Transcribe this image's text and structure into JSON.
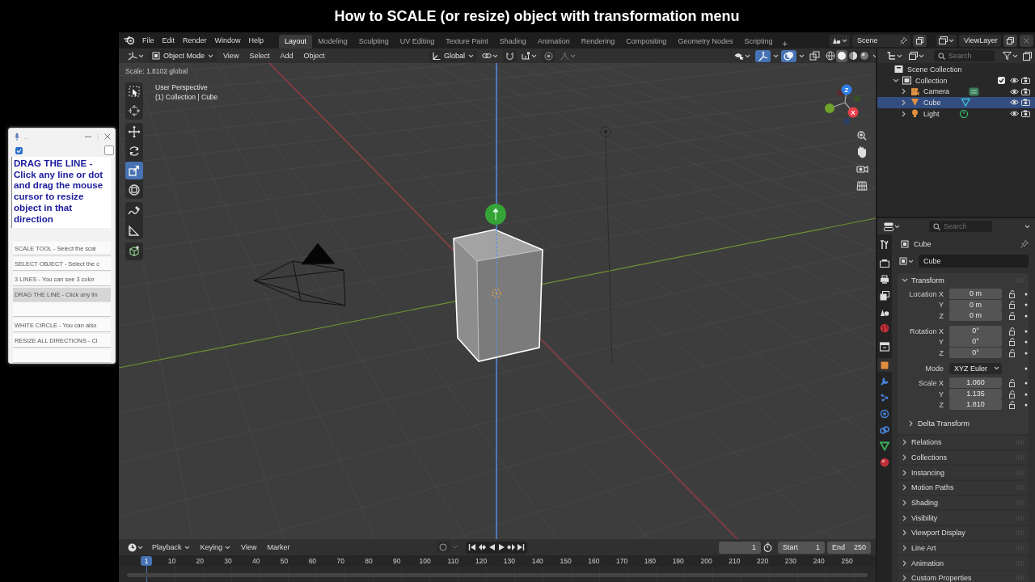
{
  "title": "How to SCALE (or resize) object with transformation menu",
  "helper": {
    "title": "..",
    "checkboxes": [
      {
        "checked": true
      },
      {
        "checked": false
      }
    ],
    "text": "DRAG THE LINE - Click any line or dot and drag the mouse cursor to resize object in that direction",
    "items": [
      {
        "kind": "entry",
        "label": "SCALE TOOL - Select the scal",
        "selected": false
      },
      {
        "kind": "entry",
        "label": "SELECT OBJECT - Select the c",
        "selected": false
      },
      {
        "kind": "entry",
        "label": "3 LINES - You can see 3 color",
        "selected": false
      },
      {
        "kind": "entry",
        "label": "DRAG THE LINE - Click any lin",
        "selected": true
      },
      {
        "kind": "blank",
        "selected": false
      },
      {
        "kind": "entry",
        "label": "WHITE CIRCLE - You can also",
        "selected": false
      },
      {
        "kind": "entry",
        "label": "RESIZE ALL DIRECTIONS - Cl",
        "selected": false
      },
      {
        "kind": "blank",
        "selected": false
      }
    ]
  },
  "topbar": {
    "menus": [
      "File",
      "Edit",
      "Render",
      "Window",
      "Help"
    ],
    "workspaces": [
      {
        "label": "Layout",
        "selected": true
      },
      {
        "label": "Modeling",
        "selected": false
      },
      {
        "label": "Sculpting",
        "selected": false
      },
      {
        "label": "UV Editing",
        "selected": false
      },
      {
        "label": "Texture Paint",
        "selected": false
      },
      {
        "label": "Shading",
        "selected": false
      },
      {
        "label": "Animation",
        "selected": false
      },
      {
        "label": "Rendering",
        "selected": false
      },
      {
        "label": "Compositing",
        "selected": false
      },
      {
        "label": "Geometry Nodes",
        "selected": false
      },
      {
        "label": "Scripting",
        "selected": false
      }
    ],
    "add": "+",
    "scene": "Scene",
    "view_layer": "ViewLayer"
  },
  "viewport": {
    "mode": "Object Mode",
    "menus": [
      "View",
      "Select",
      "Add",
      "Object"
    ],
    "orientation": "Global",
    "toggles": [
      {
        "kind": "gizmo",
        "on": true
      },
      {
        "kind": "overlay",
        "on": true
      },
      {
        "kind": "xray",
        "on": false
      }
    ],
    "shading": [
      {
        "kind": "wireframe",
        "selected": false
      },
      {
        "kind": "solid",
        "selected": true
      },
      {
        "kind": "material",
        "selected": false
      },
      {
        "kind": "rendered",
        "selected": false
      }
    ],
    "status": "Scale: 1.8102 global",
    "view_name": "User Perspective",
    "context": "(1) Collection | Cube",
    "tool_groups": [
      {
        "tools": [
          {
            "kind": "select_box",
            "selected": false
          },
          {
            "kind": "cursor",
            "selected": false
          }
        ]
      },
      {
        "tools": [
          {
            "kind": "move",
            "selected": false
          },
          {
            "kind": "rotate",
            "selected": false
          },
          {
            "kind": "scale",
            "selected": true
          },
          {
            "kind": "transform",
            "selected": false
          }
        ]
      },
      {
        "tools": [
          {
            "kind": "annotate",
            "selected": false
          },
          {
            "kind": "measure",
            "selected": false
          }
        ]
      },
      {
        "tools": [
          {
            "kind": "add_cube",
            "selected": false
          }
        ]
      }
    ],
    "gizmo_labels": [
      "Z",
      "X"
    ]
  },
  "outliner": {
    "search_placeholder": "Search",
    "tree": [
      {
        "label": "Scene Collection",
        "kind": "scene_collection",
        "selected": false,
        "children": [
          {
            "label": "Collection",
            "kind": "collection",
            "expanded": true,
            "checked": true,
            "selected": false,
            "children": [
              {
                "label": "Camera",
                "kind": "camera",
                "expanded": false,
                "selected": false
              },
              {
                "label": "Cube",
                "kind": "mesh",
                "expanded": false,
                "selected": true
              },
              {
                "label": "Light",
                "kind": "light",
                "expanded": false,
                "selected": false
              }
            ]
          }
        ]
      }
    ]
  },
  "properties": {
    "search_placeholder": "Search",
    "tab_groups": [
      {
        "tabs": [
          {
            "kind": "tool",
            "selected": false
          }
        ]
      },
      {
        "tabs": [
          {
            "kind": "render",
            "selected": false
          },
          {
            "kind": "output",
            "selected": false
          },
          {
            "kind": "view_layer",
            "selected": false
          },
          {
            "kind": "scene",
            "selected": false
          },
          {
            "kind": "world",
            "selected": false
          }
        ]
      },
      {
        "tabs": [
          {
            "kind": "collection",
            "selected": false
          }
        ]
      },
      {
        "tabs": [
          {
            "kind": "object",
            "selected": true
          },
          {
            "kind": "modifiers",
            "selected": false
          },
          {
            "kind": "particles",
            "selected": false
          },
          {
            "kind": "physics",
            "selected": false
          },
          {
            "kind": "constraints",
            "selected": false
          },
          {
            "kind": "data",
            "selected": false
          },
          {
            "kind": "material",
            "selected": false
          }
        ]
      }
    ],
    "object_name": "Cube",
    "object_field": "Cube",
    "transform": {
      "title": "Transform",
      "expanded": true,
      "groups": [
        {
          "rows": [
            {
              "kind": "number",
              "label": "Location X",
              "value": "0 m"
            },
            {
              "kind": "number",
              "label": "Y",
              "value": "0 m"
            },
            {
              "kind": "number",
              "label": "Z",
              "value": "0 m"
            }
          ]
        },
        {
          "rows": [
            {
              "kind": "number",
              "label": "Rotation X",
              "value": "0°"
            },
            {
              "kind": "number",
              "label": "Y",
              "value": "0°"
            },
            {
              "kind": "number",
              "label": "Z",
              "value": "0°"
            }
          ]
        },
        {
          "rows": [
            {
              "kind": "dropdown",
              "label": "Mode",
              "value": "XYZ Euler"
            }
          ]
        },
        {
          "rows": [
            {
              "kind": "number",
              "label": "Scale X",
              "value": "1.060"
            },
            {
              "kind": "number",
              "label": "Y",
              "value": "1.135"
            },
            {
              "kind": "number",
              "label": "Z",
              "value": "1.810"
            }
          ]
        }
      ],
      "subpanel": {
        "title": "Delta Transform",
        "expanded": false
      }
    },
    "panels": [
      {
        "title": "Relations",
        "expanded": false
      },
      {
        "title": "Collections",
        "expanded": false
      },
      {
        "title": "Instancing",
        "expanded": false
      },
      {
        "title": "Motion Paths",
        "expanded": false
      },
      {
        "title": "Shading",
        "expanded": false
      },
      {
        "title": "Visibility",
        "expanded": false
      },
      {
        "title": "Viewport Display",
        "expanded": false
      },
      {
        "title": "Line Art",
        "expanded": false
      },
      {
        "title": "Animation",
        "expanded": false
      },
      {
        "title": "Custom Properties",
        "expanded": false
      }
    ]
  },
  "timeline": {
    "menus": [
      "Playback",
      "Keying",
      "View",
      "Marker"
    ],
    "auto_key": false,
    "transport": [
      {
        "kind": "jump_start"
      },
      {
        "kind": "prev_key"
      },
      {
        "kind": "play_reverse"
      },
      {
        "kind": "play"
      },
      {
        "kind": "next_key"
      },
      {
        "kind": "jump_end"
      }
    ],
    "frame": "1",
    "start_label": "Start",
    "start": "1",
    "end_label": "End",
    "end": "250",
    "current": "1",
    "ticks": [
      "10",
      "20",
      "30",
      "40",
      "50",
      "60",
      "70",
      "80",
      "90",
      "100",
      "110",
      "120",
      "130",
      "140",
      "150",
      "160",
      "170",
      "180",
      "190",
      "200",
      "210",
      "220",
      "230",
      "240",
      "250"
    ]
  }
}
